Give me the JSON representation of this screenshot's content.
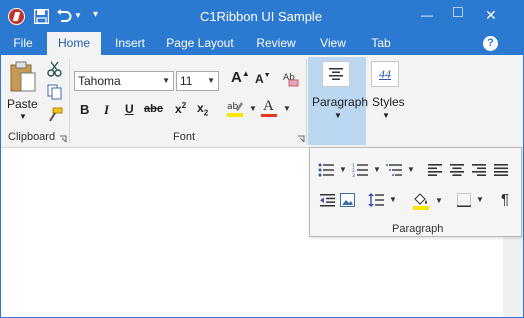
{
  "window": {
    "title": "C1Ribbon UI Sample",
    "accent": "#2b79d0",
    "active_group_highlight": "#bcd7f1"
  },
  "quick_access": {
    "save_icon": "save-icon",
    "undo_icon": "undo-icon",
    "customize_icon": "customize-qat-icon"
  },
  "window_controls": {
    "minimize": "—",
    "maximize": "□",
    "close": "✕"
  },
  "tabs": [
    {
      "label": "File"
    },
    {
      "label": "Home"
    },
    {
      "label": "Insert"
    },
    {
      "label": "Page Layout"
    },
    {
      "label": "Review"
    },
    {
      "label": "View"
    },
    {
      "label": "Tab"
    }
  ],
  "help_icon": "?",
  "clipboard": {
    "paste_label": "Paste",
    "group_label": "Clipboard"
  },
  "font": {
    "font_name": "Tahoma",
    "font_size": "11",
    "group_label": "Font",
    "bold": "B",
    "italic": "I",
    "underline": "U",
    "strike": "abc",
    "grow": "A",
    "shrink": "A",
    "font_color_letter": "A",
    "highlight_color": "#f7e600",
    "font_color": "#e8381f"
  },
  "paragraph": {
    "label": "Paragraph"
  },
  "styles": {
    "label": "Styles",
    "glyph": "44"
  },
  "popup": {
    "group_label": "Paragraph",
    "pilcrow": "¶"
  }
}
